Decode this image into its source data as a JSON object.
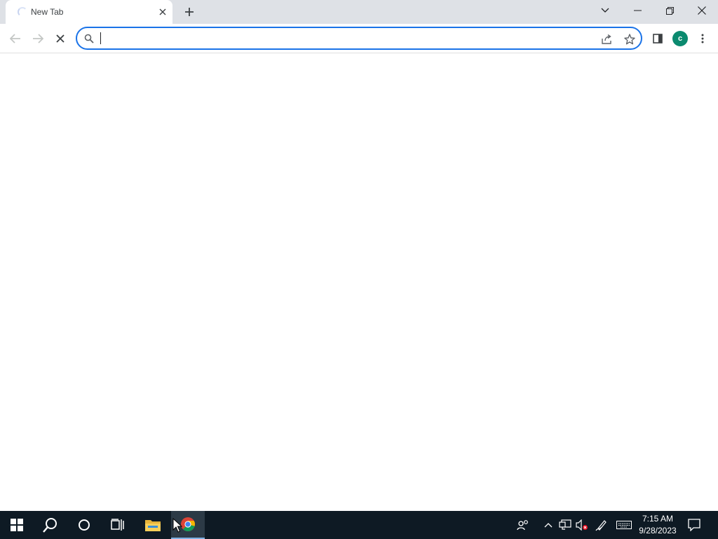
{
  "browser": {
    "tab": {
      "title": "New Tab",
      "loading": true
    },
    "new_tab_icon": "plus-icon",
    "window_controls": {
      "tab_search_icon": "chevron-down-icon",
      "minimize_icon": "minimize-icon",
      "restore_icon": "restore-icon",
      "close_icon": "close-icon"
    },
    "toolbar": {
      "back_icon": "arrow-left-icon",
      "forward_icon": "arrow-right-icon",
      "stop_icon": "stop-icon",
      "omnibox": {
        "value": "",
        "placeholder": "",
        "search_icon": "search-icon",
        "share_icon": "share-icon",
        "bookmark_icon": "star-icon"
      },
      "side_panel_icon": "side-panel-icon",
      "profile_initial": "c",
      "profile_color": "#0b8a6f",
      "menu_icon": "more-vertical-icon"
    },
    "accent_color": "#1a73e8"
  },
  "taskbar": {
    "start_icon": "windows-icon",
    "search_icon": "search-icon",
    "cortana_icon": "circle-icon",
    "task_view_icon": "task-view-icon",
    "apps": [
      {
        "name": "File Explorer",
        "icon": "folder-icon",
        "active": false
      },
      {
        "name": "Google Chrome",
        "icon": "chrome-icon",
        "active": true
      }
    ],
    "tray": {
      "people_icon": "people-icon",
      "show_hidden_icon": "chevron-up-icon",
      "network_icon": "network-icon",
      "volume_icon": "volume-muted-icon",
      "pen_icon": "pen-icon",
      "keyboard_icon": "keyboard-icon",
      "notifications_icon": "notification-icon"
    },
    "clock": {
      "time": "7:15 AM",
      "date": "9/28/2023"
    }
  }
}
